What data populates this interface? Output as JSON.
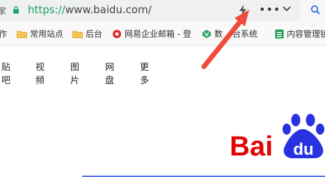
{
  "address_bar": {
    "edge_char": "家",
    "url_protocol": "https://",
    "url_host": "www.baidu.com/",
    "more_label": "•••"
  },
  "bookmarks": [
    {
      "label": "作",
      "icon": "none"
    },
    {
      "label": "常用站点",
      "icon": "folder-icon"
    },
    {
      "label": "后台",
      "icon": "folder-icon"
    },
    {
      "label": "网易企业邮箱 - 登",
      "icon": "netease-icon"
    },
    {
      "label": "数",
      "icon": "v-icon"
    },
    {
      "label": "台系统",
      "icon": "none"
    },
    {
      "label": "内容管理镜",
      "icon": "sheet-icon"
    }
  ],
  "nav": {
    "items": [
      "贴吧",
      "视频",
      "图片",
      "网盘",
      "更多"
    ]
  },
  "logo": {
    "text_bai": "Bai",
    "text_du": "du"
  },
  "colors": {
    "url_protocol": "#1aa260",
    "arrow": "#f04b3a",
    "baidu_red": "#e10602",
    "baidu_blue": "#2932e1"
  }
}
